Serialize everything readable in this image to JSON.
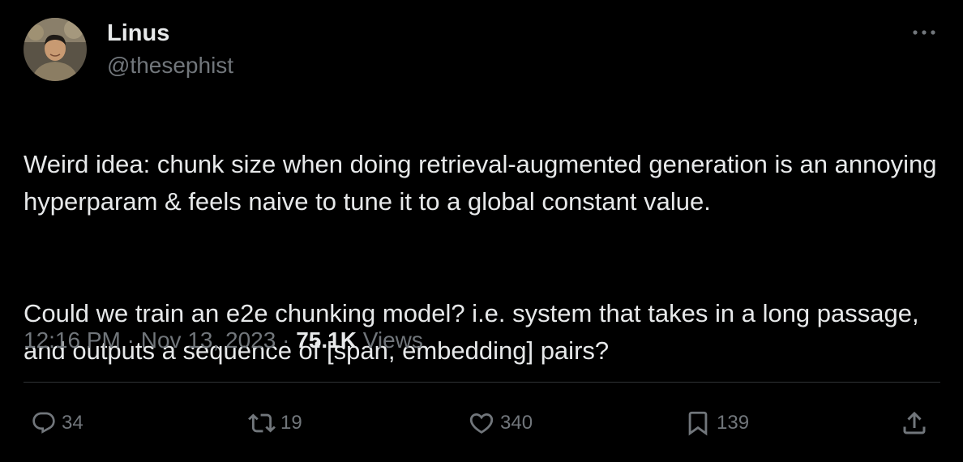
{
  "author": {
    "name": "Linus",
    "handle": "@thesephist",
    "avatar_icon": "profile-photo"
  },
  "more_icon": "ellipsis-icon",
  "tweet": {
    "paragraph_1": "Weird idea: chunk size when doing retrieval-augmented generation is an annoying hyperparam & feels naive to tune it to a global constant value.",
    "paragraph_2": "Could we train an e2e chunking model? i.e. system that takes in a long passage, and outputs a sequence of [span, embedding] pairs?"
  },
  "meta": {
    "time": "12:16 PM",
    "separator": "·",
    "date": "Nov 13, 2023",
    "views_count": "75.1K",
    "views_label": "Views"
  },
  "actions": {
    "replies": "34",
    "retweets": "19",
    "likes": "340",
    "bookmarks": "139"
  },
  "colors": {
    "background": "#000000",
    "text_primary": "#e7e9ea",
    "text_secondary": "#71767b",
    "divider": "#2f3336"
  }
}
